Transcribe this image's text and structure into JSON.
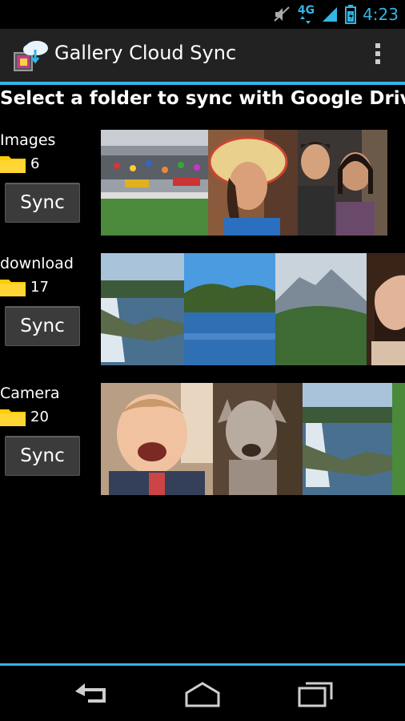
{
  "status": {
    "network": "4G",
    "time": "4:23"
  },
  "app": {
    "title": "Gallery Cloud Sync"
  },
  "heading": "Select a folder to sync with Google Drive",
  "folders": [
    {
      "name": "Images",
      "count": "6",
      "sync_label": "Sync"
    },
    {
      "name": "download",
      "count": "17",
      "sync_label": "Sync"
    },
    {
      "name": "Camera",
      "count": "20",
      "sync_label": "Sync"
    }
  ],
  "colors": {
    "accent": "#33b5e5",
    "actionbar": "#222222",
    "folder": "#ffcc00"
  },
  "icons": {
    "status": [
      "mute-icon",
      "signal-icon",
      "battery-icon"
    ],
    "navbar": [
      "back-icon",
      "home-icon",
      "recent-apps-icon"
    ],
    "actionbar": [
      "app-icon",
      "overflow-menu-icon"
    ]
  }
}
